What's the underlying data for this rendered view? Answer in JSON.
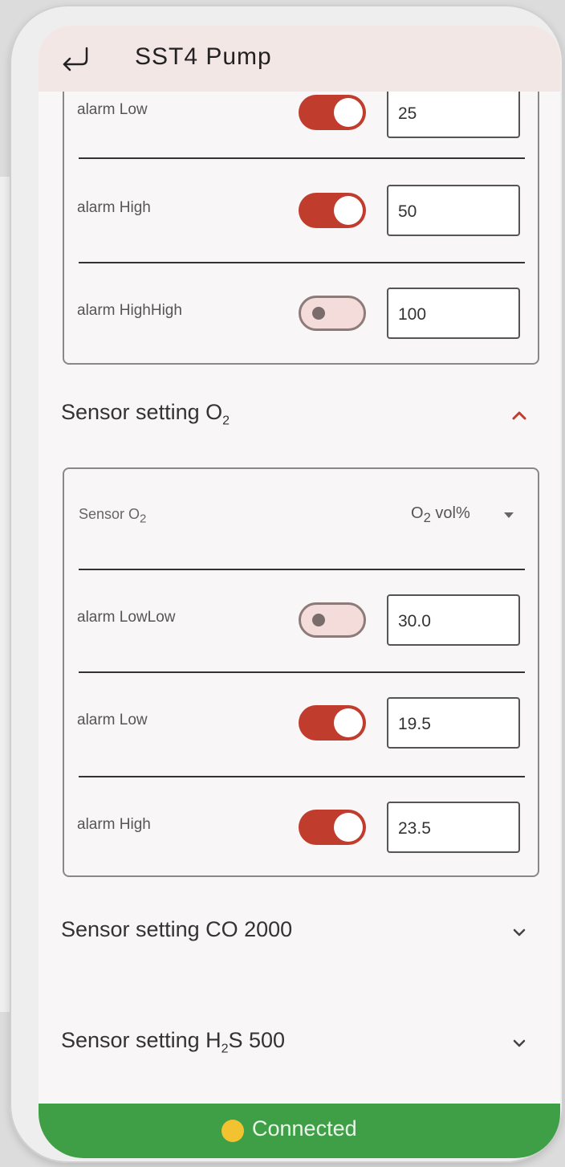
{
  "app": {
    "title": "SST4 Pump"
  },
  "first_group": {
    "rows": [
      {
        "label": "alarm Low",
        "enabled": true,
        "value": "25"
      },
      {
        "label": "alarm High",
        "enabled": true,
        "value": "50"
      },
      {
        "label": "alarm HighHigh",
        "enabled": false,
        "value": "100"
      }
    ]
  },
  "o2_section": {
    "title_prefix": "Sensor setting O",
    "title_sub": "2",
    "expanded": true,
    "sensor_label_prefix": "Sensor O",
    "sensor_label_sub": "2",
    "sensor_select_prefix": "O",
    "sensor_select_sub": "2",
    "sensor_select_suffix": " vol%",
    "rows": [
      {
        "label": "alarm LowLow",
        "enabled": false,
        "value": "30.0"
      },
      {
        "label": "alarm Low",
        "enabled": true,
        "value": "19.5"
      },
      {
        "label": "alarm High",
        "enabled": true,
        "value": "23.5"
      }
    ]
  },
  "co_section": {
    "title": "Sensor setting CO 2000",
    "expanded": false
  },
  "h2s_section": {
    "title_prefix": "Sensor setting H",
    "title_sub": "2",
    "title_suffix": "S 500",
    "expanded": false
  },
  "status": {
    "text": "Connected",
    "color": "#3f9f46"
  },
  "colors": {
    "accent": "#c03c2d",
    "appbar": "#f3e7e5"
  }
}
